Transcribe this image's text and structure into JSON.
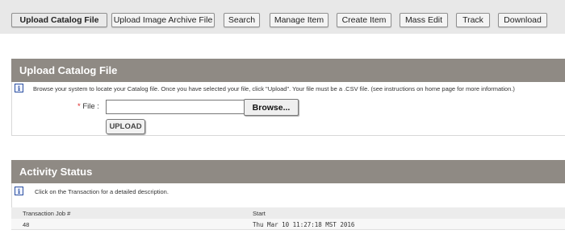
{
  "nav": {
    "items": [
      {
        "label": "Upload Catalog File",
        "active": true
      },
      {
        "label": "Upload Image Archive File",
        "active": false
      },
      {
        "label": "Search",
        "active": false
      },
      {
        "label": "Manage Item",
        "active": false
      },
      {
        "label": "Create Item",
        "active": false
      },
      {
        "label": "Mass Edit",
        "active": false
      },
      {
        "label": "Track",
        "active": false
      },
      {
        "label": "Download",
        "active": false
      }
    ]
  },
  "upload_section": {
    "title": "Upload Catalog File",
    "info_text": "Browse your system to locate your Catalog file. Once you have selected your file, click \"Upload\". Your file must be a .CSV file. (see instructions on home page for more information.)",
    "file_required_marker": "*",
    "file_label": "File :",
    "file_value": "",
    "browse_label": "Browse...",
    "upload_label": "UPLOAD"
  },
  "activity_section": {
    "title": "Activity Status",
    "info_text": "Click on the Transaction for a detailed description.",
    "columns": [
      "Transaction Job #",
      "Start"
    ],
    "rows": [
      [
        "48",
        "Thu Mar 10 11:27:18 MST 2016"
      ]
    ]
  },
  "colors": {
    "section_header_bg": "#8f8a84",
    "info_icon": "#2b4fa0"
  },
  "icons": {
    "info": "i"
  }
}
